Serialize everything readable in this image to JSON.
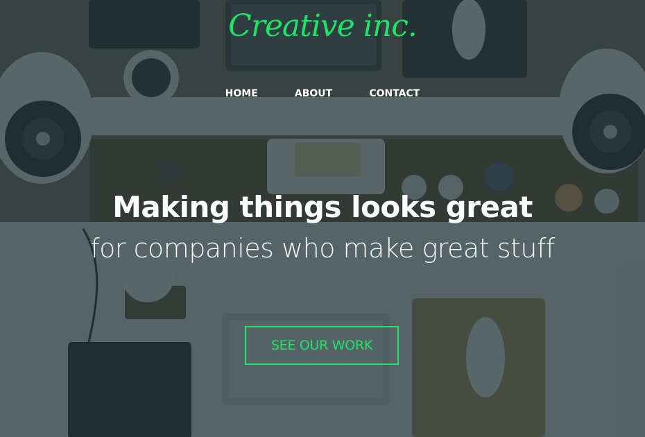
{
  "brand": {
    "logo_text": "Creative inc.",
    "accent_color": "#22e36a"
  },
  "nav": {
    "items": [
      {
        "label": "HOME"
      },
      {
        "label": "ABOUT"
      },
      {
        "label": "CONTACT"
      }
    ]
  },
  "hero": {
    "headline": "Making things looks great",
    "subline": "for companies who make great stuff",
    "cta_label": "SEE OUR WORK",
    "background_image": "overhead-desk-workspace-photo"
  }
}
